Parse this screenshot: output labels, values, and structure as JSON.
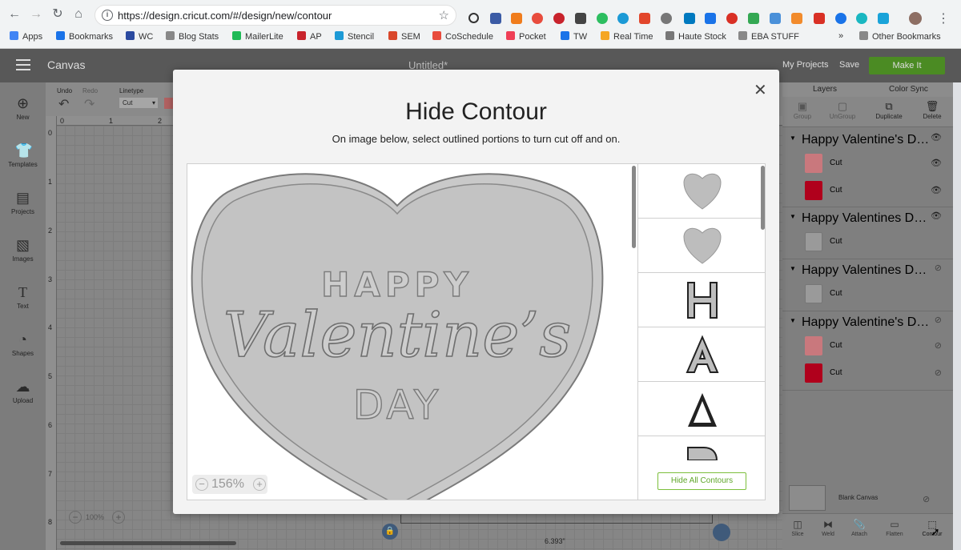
{
  "browser": {
    "url": "https://design.cricut.com/#/design/new/contour",
    "bookmarks": [
      "Apps",
      "Bookmarks",
      "WC",
      "Blog Stats",
      "MailerLite",
      "AP",
      "Stencil",
      "SEM",
      "CoSchedule",
      "Pocket",
      "TW",
      "Real Time",
      "Haute Stock",
      "EBA STUFF",
      "»",
      "Other Bookmarks"
    ]
  },
  "app": {
    "title": "Canvas",
    "document_title": "Untitled*",
    "my_projects": "My Projects",
    "save": "Save",
    "make_it": "Make It"
  },
  "sidebar": {
    "items": [
      {
        "label": "New",
        "icon": "plus-circle-icon"
      },
      {
        "label": "Templates",
        "icon": "shirt-icon"
      },
      {
        "label": "Projects",
        "icon": "projects-icon"
      },
      {
        "label": "Images",
        "icon": "image-icon"
      },
      {
        "label": "Text",
        "icon": "text-icon"
      },
      {
        "label": "Shapes",
        "icon": "shapes-icon"
      },
      {
        "label": "Upload",
        "icon": "upload-cloud-icon"
      }
    ]
  },
  "toolbar": {
    "undo": "Undo",
    "redo": "Redo",
    "linetype_label": "Linetype",
    "linetype_value": "Cut"
  },
  "canvas": {
    "ruler_top": [
      "0",
      "1",
      "2"
    ],
    "ruler_left": [
      "0",
      "1",
      "2",
      "3",
      "4",
      "5",
      "6",
      "7",
      "8"
    ],
    "zoom": "100%",
    "width_dim": "6.393\""
  },
  "layers": {
    "tabs": [
      "Layers",
      "Color Sync"
    ],
    "tools": [
      "Group",
      "UnGroup",
      "Duplicate",
      "Delete"
    ],
    "groups": [
      {
        "name": "Happy Valentine's Day Valen...",
        "items": [
          {
            "label": "Cut",
            "color": "#c9787d"
          },
          {
            "label": "Cut",
            "color": "#b0001c"
          }
        ]
      },
      {
        "name": "Happy Valentines Day Heart",
        "items": [
          {
            "label": "Cut",
            "color": "#9a9a9a"
          }
        ]
      },
      {
        "name": "Happy Valentines Day Heart",
        "items": [
          {
            "label": "Cut",
            "color": "#9a9a9a"
          }
        ]
      },
      {
        "name": "Happy Valentine's Day Valen...",
        "items": [
          {
            "label": "Cut",
            "color": "#c9787d"
          },
          {
            "label": "Cut",
            "color": "#b0001c"
          }
        ]
      }
    ],
    "blank_canvas": "Blank Canvas",
    "bottom_tools": [
      "Slice",
      "Weld",
      "Attach",
      "Flatten",
      "Contour"
    ]
  },
  "dialog": {
    "title": "Hide Contour",
    "subtitle": "On image below, select outlined portions to turn cut off and on.",
    "preview_text": {
      "line1": "HAPPY",
      "line2": "Valentine’s",
      "line3": "DAY"
    },
    "zoom": "156%",
    "hide_all": "Hide All Contours",
    "contour_thumbs": [
      "heart",
      "heart",
      "H",
      "A",
      "inner-a",
      "D"
    ]
  }
}
